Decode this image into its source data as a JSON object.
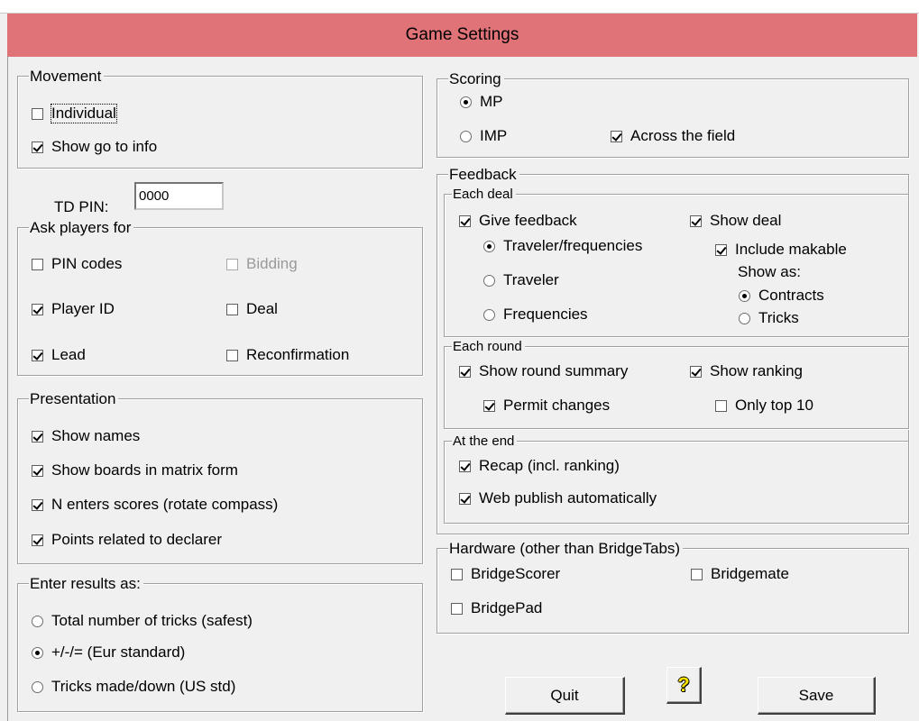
{
  "window": {
    "title": "Game Settings"
  },
  "movement": {
    "title": "Movement",
    "individual": {
      "label": "Individual",
      "checked": false
    },
    "show_go_to_info": {
      "label": "Show go to info",
      "checked": true
    }
  },
  "td_pin": {
    "label": "TD PIN:",
    "value": "0000"
  },
  "ask_players": {
    "title": "Ask players for",
    "pin_codes": {
      "label": "PIN codes",
      "checked": false
    },
    "bidding": {
      "label": "Bidding",
      "checked": false,
      "disabled": true
    },
    "player_id": {
      "label": "Player ID",
      "checked": true
    },
    "deal": {
      "label": "Deal",
      "checked": false
    },
    "lead": {
      "label": "Lead",
      "checked": true
    },
    "reconfirmation": {
      "label": "Reconfirmation",
      "checked": false
    }
  },
  "presentation": {
    "title": "Presentation",
    "show_names": {
      "label": "Show names",
      "checked": true
    },
    "show_boards_matrix": {
      "label": "Show boards in matrix form",
      "checked": true
    },
    "n_enters_scores": {
      "label": "N enters scores (rotate compass)",
      "checked": true
    },
    "points_related": {
      "label": "Points related to declarer",
      "checked": true
    }
  },
  "enter_results": {
    "title": "Enter results as:",
    "total_tricks": {
      "label": "Total number of tricks (safest)",
      "selected": false
    },
    "plus_minus": {
      "label": "+/-/= (Eur standard)",
      "selected": true
    },
    "tricks_made_down": {
      "label": "Tricks made/down (US std)",
      "selected": false
    }
  },
  "scoring": {
    "title": "Scoring",
    "mp": {
      "label": "MP",
      "selected": true
    },
    "imp": {
      "label": "IMP",
      "selected": false
    },
    "across_field": {
      "label": "Across the field",
      "checked": true
    }
  },
  "feedback": {
    "title": "Feedback",
    "each_deal": {
      "title": "Each deal",
      "give_feedback": {
        "label": "Give feedback",
        "checked": true
      },
      "traveler_frequencies": {
        "label": "Traveler/frequencies",
        "selected": true
      },
      "traveler": {
        "label": "Traveler",
        "selected": false
      },
      "frequencies": {
        "label": "Frequencies",
        "selected": false
      },
      "show_deal": {
        "label": "Show deal",
        "checked": true
      },
      "include_makable": {
        "label": "Include makable",
        "checked": true
      },
      "show_as_label": "Show as:",
      "contracts": {
        "label": "Contracts",
        "selected": true
      },
      "tricks": {
        "label": "Tricks",
        "selected": false
      }
    },
    "each_round": {
      "title": "Each round",
      "show_round_summary": {
        "label": "Show round summary",
        "checked": true
      },
      "show_ranking": {
        "label": "Show ranking",
        "checked": true
      },
      "permit_changes": {
        "label": "Permit changes",
        "checked": true
      },
      "only_top_10": {
        "label": "Only top 10",
        "checked": false
      }
    },
    "at_the_end": {
      "title": "At the end",
      "recap": {
        "label": "Recap (incl. ranking)",
        "checked": true
      },
      "web_publish": {
        "label": "Web publish automatically",
        "checked": true
      }
    }
  },
  "hardware": {
    "title": "Hardware (other than BridgeTabs)",
    "bridgescorer": {
      "label": "BridgeScorer",
      "checked": false
    },
    "bridgemate": {
      "label": "Bridgemate",
      "checked": false
    },
    "bridgepad": {
      "label": "BridgePad",
      "checked": false
    }
  },
  "buttons": {
    "quit": "Quit",
    "help": "?",
    "save": "Save"
  },
  "colors": {
    "title_bar": "#e07377",
    "background": "#f0f0f0",
    "help_icon": "#f5e000"
  }
}
